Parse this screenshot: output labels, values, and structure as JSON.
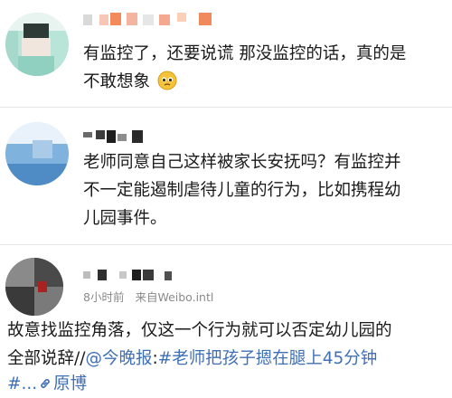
{
  "comments": [
    {
      "lines": [
        "有监控了，还要说谎 那没监控的话，真的是",
        "不敢想象"
      ],
      "emoji_icon": "pleading-face-emoji"
    },
    {
      "lines": [
        "老师同意自己这样被家长安抚吗？有监控并",
        "不一定能遏制虐待儿童的行为，比如携程幼",
        "儿园事件。"
      ]
    },
    {
      "meta": {
        "time": "8小时前",
        "source": "来自Weibo.intl"
      },
      "line1": "故意找监控角落，仅这一个行为就可以否定幼儿园的",
      "line2_prefix": "全部说辞//",
      "mention": "@今晚报",
      "colon": ":",
      "hashtag": "#老师把孩子摁在腿上45分钟",
      "line3_prefix": "#...",
      "link_text": "原博",
      "link_icon": "link-icon"
    }
  ]
}
